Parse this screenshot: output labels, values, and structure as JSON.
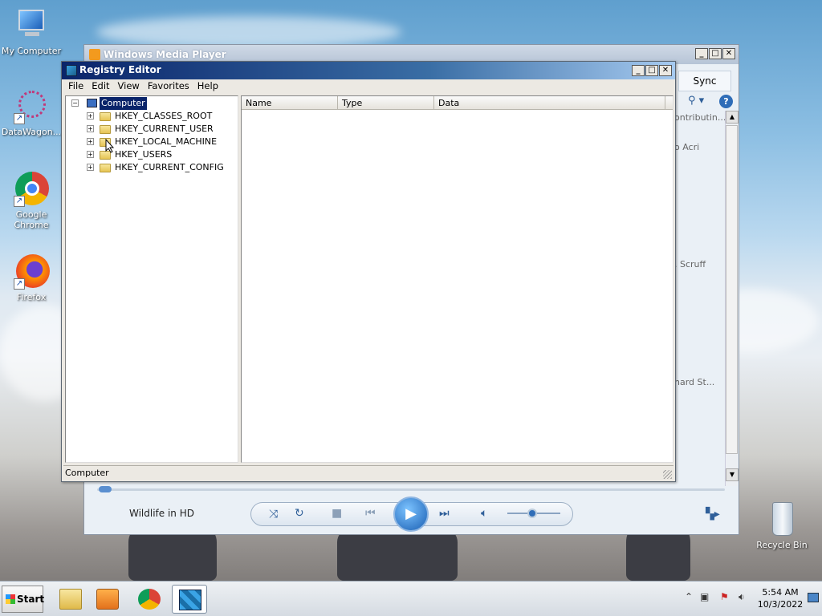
{
  "desktop": {
    "icons": [
      {
        "label": "My Computer"
      },
      {
        "label": "DataWagon..."
      },
      {
        "label": "Google Chrome"
      },
      {
        "label": "Firefox"
      },
      {
        "label": "Recycle Bin"
      }
    ]
  },
  "wmp": {
    "title": "Windows Media Player",
    "sync_tab": "Sync",
    "side_texts": [
      "ontributin...",
      "o Acri",
      ". Scruff",
      "hard St..."
    ],
    "now_playing": "Wildlife in HD",
    "seek_progress": 0.01,
    "volume_level": 0.5
  },
  "regedit": {
    "title": "Registry Editor",
    "menu": [
      "File",
      "Edit",
      "View",
      "Favorites",
      "Help"
    ],
    "tree": {
      "root": "Computer",
      "children": [
        "HKEY_CLASSES_ROOT",
        "HKEY_CURRENT_USER",
        "HKEY_LOCAL_MACHINE",
        "HKEY_USERS",
        "HKEY_CURRENT_CONFIG"
      ]
    },
    "columns": [
      "Name",
      "Type",
      "Data"
    ],
    "status": "Computer"
  },
  "taskbar": {
    "start_label": "Start",
    "time": "5:54 AM",
    "date": "10/3/2022"
  },
  "colors": {
    "title_active": "#0a246a",
    "selection": "#0a246a",
    "wmp_accent": "#2f5f99"
  },
  "icons": [
    "computer-icon",
    "datawagon-icon",
    "chrome-icon",
    "firefox-icon",
    "recycle-bin-icon",
    "folder-icon",
    "play-icon"
  ]
}
